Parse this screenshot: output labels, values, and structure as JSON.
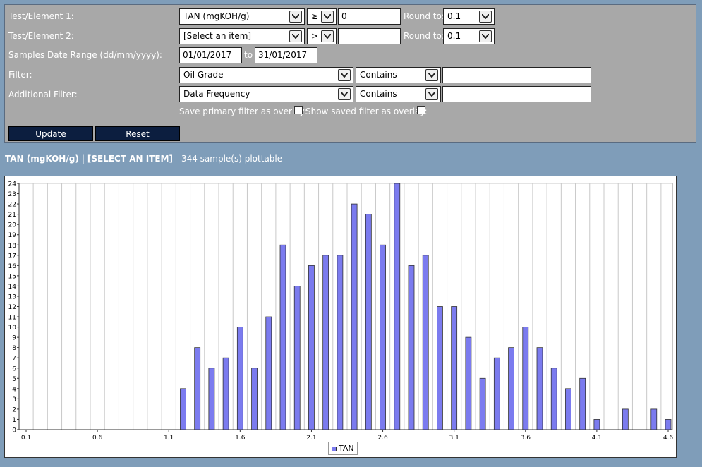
{
  "filters": {
    "row1": {
      "label": "Test/Element 1:",
      "test": "TAN (mgKOH/g)",
      "operator": "≥",
      "value": "0",
      "round_label": "Round to:",
      "round": "0.1"
    },
    "row2": {
      "label": "Test/Element 2:",
      "test": "[Select an item]",
      "operator": ">",
      "value": "",
      "round_label": "Round to:",
      "round": "0.1"
    },
    "date": {
      "label": "Samples Date Range (dd/mm/yyyy):",
      "from": "01/01/2017",
      "to_label": "to",
      "to": "31/01/2017"
    },
    "filter": {
      "label": "Filter:",
      "field": "Oil Grade",
      "mode": "Contains",
      "value": ""
    },
    "additional": {
      "label": "Additional Filter:",
      "field": "Data Frequency",
      "mode": "Contains",
      "value": ""
    },
    "overlay": {
      "save_label": "Save primary filter as overlay:",
      "save_checked": false,
      "show_label": "Show saved filter as overlay:",
      "show_checked": false
    },
    "buttons": {
      "update": "Update",
      "reset": "Reset"
    }
  },
  "summary": {
    "test1": "TAN (mgKOH/g)",
    "sep": "|",
    "test2": "[SELECT AN ITEM]",
    "rest": "- 344 sample(s) plottable"
  },
  "legend": {
    "label": "TAN"
  },
  "colors": {
    "bar": "#7b7bef",
    "panel": "#a8a8a8",
    "background": "#7f9db9",
    "button": "#0c1e3f"
  },
  "chart_data": {
    "type": "bar",
    "series": [
      {
        "name": "TAN",
        "x": [
          1.2,
          1.3,
          1.4,
          1.5,
          1.6,
          1.7,
          1.8,
          1.9,
          2.0,
          2.1,
          2.2,
          2.3,
          2.4,
          2.5,
          2.6,
          2.7,
          2.8,
          2.9,
          3.0,
          3.1,
          3.2,
          3.3,
          3.4,
          3.5,
          3.6,
          3.7,
          3.8,
          3.9,
          4.0,
          4.1,
          4.3,
          4.5,
          4.6
        ],
        "values": [
          4,
          8,
          6,
          7,
          10,
          6,
          11,
          18,
          14,
          16,
          17,
          17,
          22,
          21,
          18,
          24,
          16,
          17,
          12,
          12,
          9,
          5,
          7,
          8,
          10,
          8,
          6,
          4,
          5,
          1,
          2,
          2,
          1
        ]
      }
    ],
    "xlim": [
      0.1,
      4.6
    ],
    "xticks": [
      "0.1",
      "0.6",
      "1.1",
      "1.6",
      "2.1",
      "2.6",
      "3.1",
      "3.6",
      "4.1",
      "4.6"
    ],
    "ylim": [
      0,
      24
    ],
    "yticks": [
      "0",
      "1",
      "2",
      "3",
      "4",
      "5",
      "6",
      "7",
      "8",
      "9",
      "10",
      "11",
      "12",
      "13",
      "14",
      "15",
      "16",
      "17",
      "18",
      "19",
      "20",
      "21",
      "22",
      "23",
      "24"
    ],
    "grid": true,
    "legend_position": "bottom-center"
  }
}
